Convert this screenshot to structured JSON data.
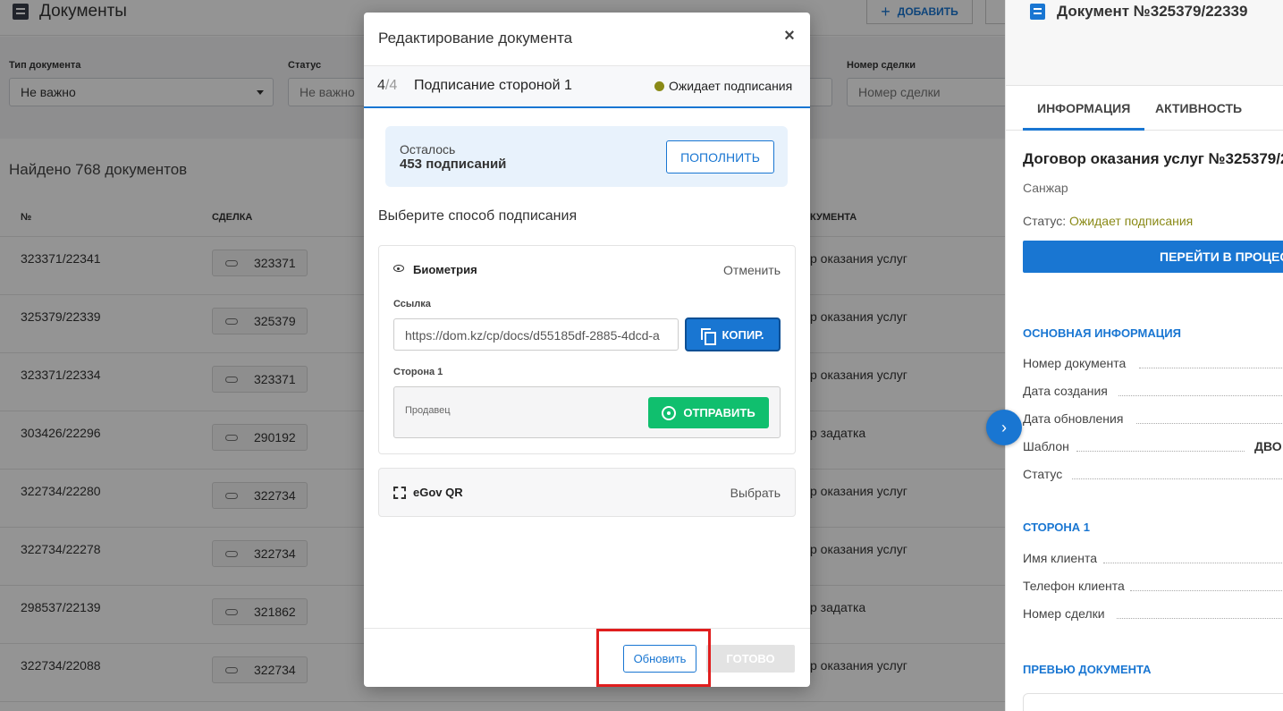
{
  "header": {
    "title": "Документы",
    "add_label": "ДОБАВИТЬ"
  },
  "filters": {
    "doc_type_label": "Тип документа",
    "doc_type_value": "Не важно",
    "status_label": "Статус",
    "status_value": "Не важно",
    "deal_number_label": "Номер сделки",
    "deal_number_placeholder": "Номер сделки"
  },
  "list": {
    "found_text": "Найдено 768 документов",
    "columns": {
      "number": "№",
      "deal": "СДЕЛКА",
      "type": "КУМЕНТА"
    },
    "rows": [
      {
        "number": "323371/22341",
        "deal": "323371",
        "type": "р оказания услуг"
      },
      {
        "number": "325379/22339",
        "deal": "325379",
        "type": "р оказания услуг"
      },
      {
        "number": "323371/22334",
        "deal": "323371",
        "type": "р оказания услуг"
      },
      {
        "number": "303426/22296",
        "deal": "290192",
        "type": "р задатка"
      },
      {
        "number": "322734/22280",
        "deal": "322734",
        "type": "р оказания услуг"
      },
      {
        "number": "322734/22278",
        "deal": "322734",
        "type": "р оказания услуг"
      },
      {
        "number": "298537/22139",
        "deal": "321862",
        "type": "р задатка"
      },
      {
        "number": "322734/22088",
        "deal": "322734",
        "type": "р оказания услуг"
      }
    ]
  },
  "right_panel": {
    "title": "Документ №325379/22339",
    "tabs": [
      "ИНФОРМАЦИЯ",
      "АКТИВНОСТЬ"
    ],
    "doc_name": "Договор оказания услуг №325379/2",
    "person": "Санжар",
    "status_label": "Статус: ",
    "status_value": "Ожидает подписания",
    "go_button": "ПЕРЕЙТИ В ПРОЦЕС",
    "section_main": "ОСНОВНАЯ ИНФОРМАЦИЯ",
    "fields_main": [
      "Номер документа",
      "Дата создания",
      "Дата обновления",
      "Шаблон",
      "Статус"
    ],
    "template_value": "ДВО",
    "section_party": "СТОРОНА 1",
    "fields_party": [
      "Имя клиента",
      "Телефон клиента",
      "Номер сделки"
    ],
    "section_preview": "ПРЕВЬЮ ДОКУМЕНТА",
    "toggle_icon": "›"
  },
  "modal": {
    "title": "Редактирование документа",
    "close_icon": "×",
    "step_current": "4",
    "step_total": "/4",
    "step_name": "Подписание стороной 1",
    "step_status": "Ожидает подписания",
    "balance_label": "Осталось",
    "balance_value": "453 подписаний",
    "topup_button": "ПОПОЛНИТЬ",
    "choose_method": "Выберите способ подписания",
    "biometry": {
      "name": "Биометрия",
      "cancel": "Отменить",
      "link_label": "Ссылка",
      "link_value": "https://dom.kz/cp/docs/d55185df-2885-4dcd-a",
      "copy_button": "КОПИР.",
      "party_label": "Сторона 1",
      "party_role": "Продавец",
      "send_button": "ОТПРАВИТЬ"
    },
    "egov": {
      "name": "eGov QR",
      "pick": "Выбрать"
    },
    "refresh_button": "Обновить",
    "done_button": "ГОТОВО"
  },
  "colors": {
    "primary": "#1976d2",
    "whatsapp": "#10bf6e",
    "status_pending": "#8a8a17",
    "highlight": "#e01e1e"
  }
}
